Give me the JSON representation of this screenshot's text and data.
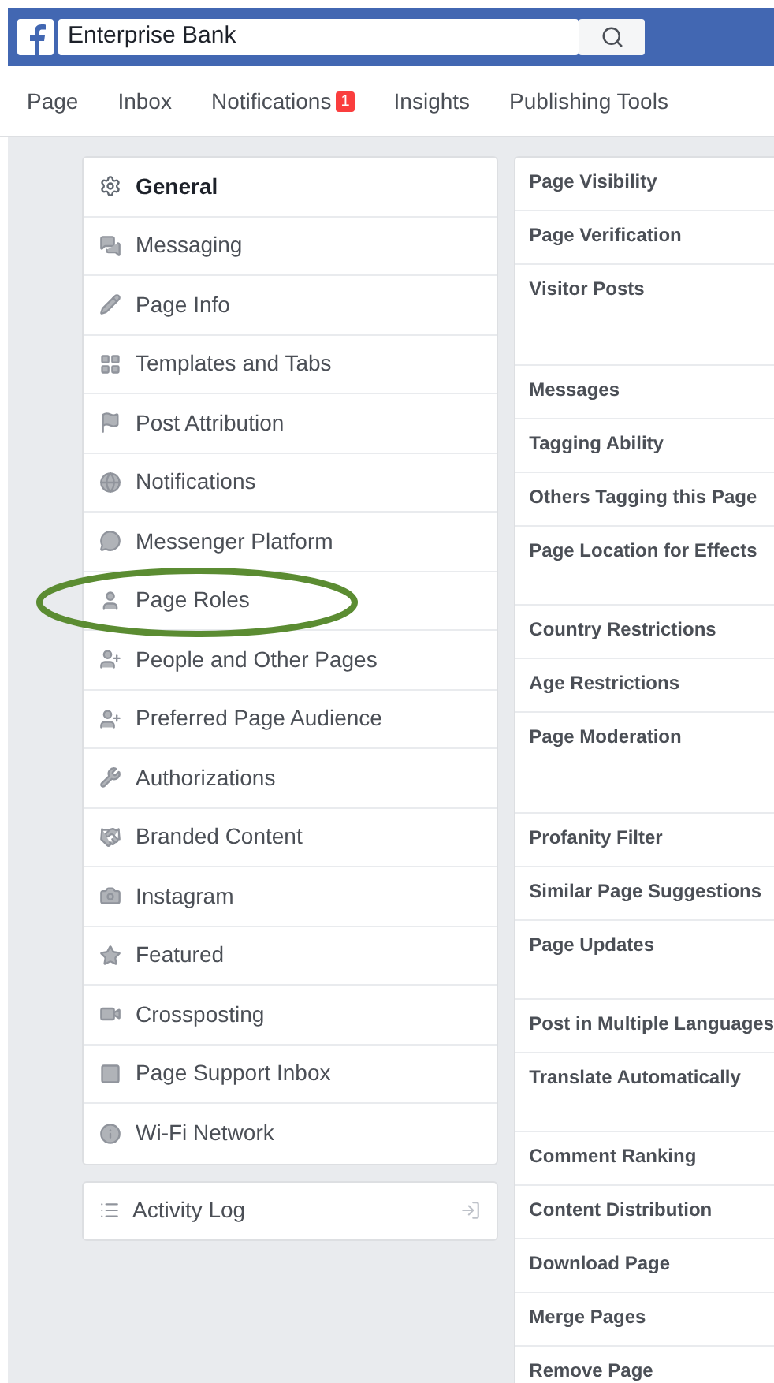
{
  "search": {
    "value": "Enterprise Bank"
  },
  "tabs": [
    {
      "label": "Page"
    },
    {
      "label": "Inbox"
    },
    {
      "label": "Notifications",
      "badge": "1"
    },
    {
      "label": "Insights"
    },
    {
      "label": "Publishing Tools"
    }
  ],
  "sidebar": {
    "items": [
      {
        "label": "General",
        "selected": true
      },
      {
        "label": "Messaging",
        "selected": false
      },
      {
        "label": "Page Info",
        "selected": false
      },
      {
        "label": "Templates and Tabs",
        "selected": false
      },
      {
        "label": "Post Attribution",
        "selected": false
      },
      {
        "label": "Notifications",
        "selected": false
      },
      {
        "label": "Messenger Platform",
        "selected": false
      },
      {
        "label": "Page Roles",
        "selected": false
      },
      {
        "label": "People and Other Pages",
        "selected": false
      },
      {
        "label": "Preferred Page Audience",
        "selected": false
      },
      {
        "label": "Authorizations",
        "selected": false
      },
      {
        "label": "Branded Content",
        "selected": false
      },
      {
        "label": "Instagram",
        "selected": false
      },
      {
        "label": "Featured",
        "selected": false
      },
      {
        "label": "Crossposting",
        "selected": false
      },
      {
        "label": "Page Support Inbox",
        "selected": false
      },
      {
        "label": "Wi-Fi Network",
        "selected": false
      }
    ]
  },
  "activity_log": {
    "label": "Activity Log"
  },
  "settings": [
    {
      "label": "Page Visibility",
      "kind": "short"
    },
    {
      "label": "Page Verification",
      "kind": "short"
    },
    {
      "label": "Visitor Posts",
      "kind": "tall"
    },
    {
      "label": "Messages",
      "kind": "short"
    },
    {
      "label": "Tagging Ability",
      "kind": "short"
    },
    {
      "label": "Others Tagging this Page",
      "kind": "short"
    },
    {
      "label": "Page Location for Effects",
      "kind": "medium"
    },
    {
      "label": "Country Restrictions",
      "kind": "short"
    },
    {
      "label": "Age Restrictions",
      "kind": "short"
    },
    {
      "label": "Page Moderation",
      "kind": "tall"
    },
    {
      "label": "Profanity Filter",
      "kind": "short"
    },
    {
      "label": "Similar Page Suggestions",
      "kind": "short"
    },
    {
      "label": "Page Updates",
      "kind": "medium"
    },
    {
      "label": "Post in Multiple Languages",
      "kind": "short"
    },
    {
      "label": "Translate Automatically",
      "kind": "medium"
    },
    {
      "label": "Comment Ranking",
      "kind": "short"
    },
    {
      "label": "Content Distribution",
      "kind": "short"
    },
    {
      "label": "Download Page",
      "kind": "short"
    },
    {
      "label": "Merge Pages",
      "kind": "short"
    },
    {
      "label": "Remove Page",
      "kind": "short"
    }
  ]
}
